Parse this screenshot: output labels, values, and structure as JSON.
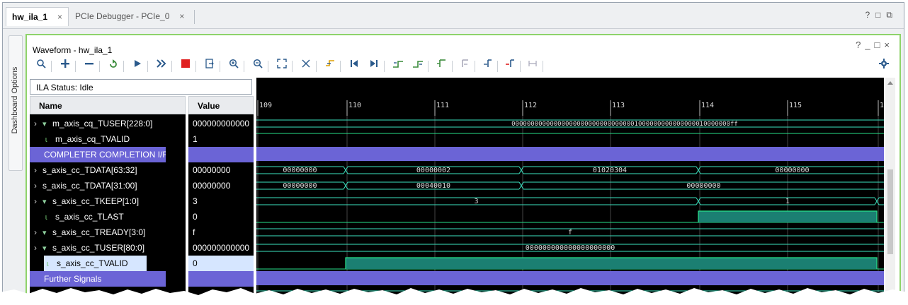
{
  "tabs": [
    {
      "label": "hw_ila_1",
      "close": "×"
    },
    {
      "label": "PCIe Debugger - PCIe_0",
      "close": "×"
    }
  ],
  "window_controls": [
    "?",
    "□",
    "⧉"
  ],
  "sidebar_label": "Dashboard Options",
  "panel": {
    "title": "Waveform - hw_ila_1",
    "controls": [
      "?",
      "_",
      "□",
      "×"
    ]
  },
  "toolbar_icons": [
    "search-icon",
    "zoom-in-plus-icon",
    "minus-icon",
    "refresh-icon",
    "run-trigger-icon",
    "run-immediate-icon",
    "stop-icon",
    "export-icon",
    "zoom-in-icon",
    "zoom-out-icon",
    "zoom-fit-icon",
    "auto-fit-icon",
    "go-to-time-0-icon",
    "previous-transition-icon",
    "next-transition-icon",
    "add-marker-icon",
    "previous-marker-icon",
    "next-marker-icon",
    "swap-cursors-icon",
    "cursor-icon",
    "add-cursor-icon",
    "remove-cursor-icon",
    "settings-icon"
  ],
  "ila_status": "ILA Status: Idle",
  "columns": {
    "name": "Name",
    "value": "Value"
  },
  "signals": [
    {
      "name": "m_axis_cq_TUSER[228:0]",
      "value": "000000000000",
      "kind": "bus",
      "wave": "000000000000000000000000000000001000000000000000010000000ff"
    },
    {
      "name": "m_axis_cq_TVALID",
      "value": "1",
      "kind": "bit"
    },
    {
      "name": "COMPLETER COMPLETION I/F",
      "value": "",
      "kind": "divider"
    },
    {
      "name": "s_axis_cc_TDATA[63:32]",
      "value": "00000000",
      "kind": "bus-no-icon",
      "segments": [
        "00000000",
        "00000002",
        "01020304",
        "00000000"
      ]
    },
    {
      "name": "s_axis_cc_TDATA[31:00]",
      "value": "00000000",
      "kind": "bus-no-icon",
      "segments": [
        "00000000",
        "00040010",
        "00000000"
      ]
    },
    {
      "name": "s_axis_cc_TKEEP[1:0]",
      "value": "3",
      "kind": "bus",
      "segments": [
        "3",
        "1"
      ]
    },
    {
      "name": "s_axis_cc_TLAST",
      "value": "0",
      "kind": "bit"
    },
    {
      "name": "s_axis_cc_TREADY[3:0]",
      "value": "f",
      "kind": "bus",
      "segments": [
        "f"
      ]
    },
    {
      "name": "s_axis_cc_TUSER[80:0]",
      "value": "000000000000",
      "kind": "bus",
      "segments": [
        "000000000000000000000"
      ]
    },
    {
      "name": "s_axis_cc_TVALID",
      "value": "0",
      "kind": "bit-selected"
    },
    {
      "name": "Further Signals",
      "value": "",
      "kind": "divider"
    }
  ],
  "timeline_ticks": [
    "109",
    "110",
    "111",
    "112",
    "113",
    "114",
    "115",
    "1"
  ],
  "colors": {
    "accent_green": "#8ed36a",
    "divider": "#6b64d6",
    "wave_green": "#1b7f72",
    "wave_edge": "#3be3c0",
    "selected_row": "#d6e6ff"
  }
}
